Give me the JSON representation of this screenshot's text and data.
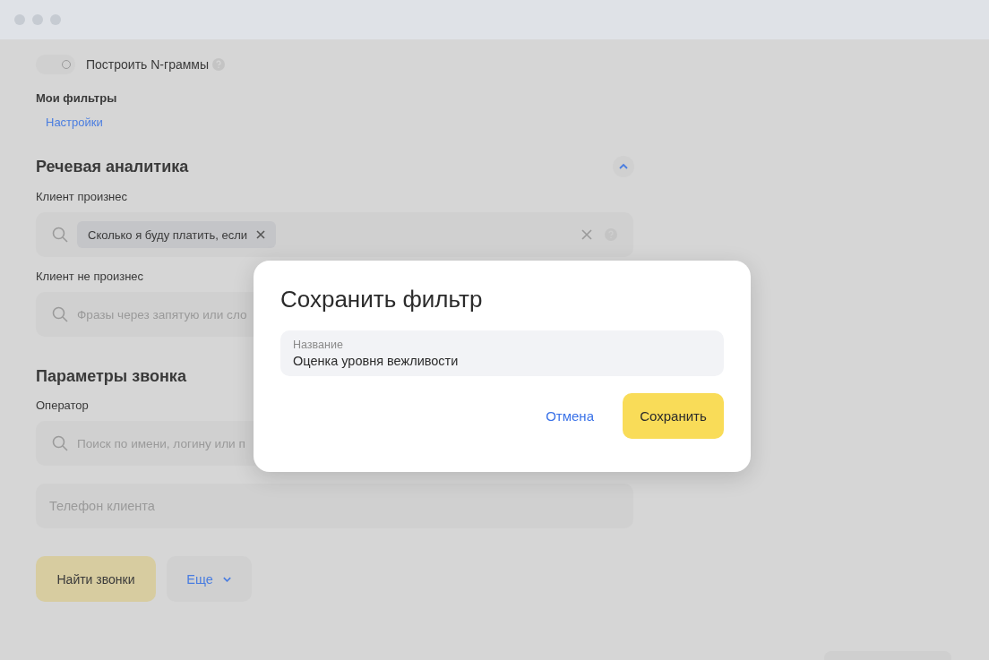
{
  "ngram_toggle": {
    "label": "Построить N-граммы",
    "on": false
  },
  "my_filters": {
    "title": "Мои фильтры",
    "link": "Настройки"
  },
  "speech_section": {
    "title": "Речевая аналитика",
    "expanded": true,
    "fields": [
      {
        "label": "Клиент произнес",
        "chips": [
          "Сколько я буду платить, если"
        ]
      },
      {
        "label": "Клиент не произнес",
        "placeholder": "Фразы через запятую или сло"
      }
    ]
  },
  "call_section": {
    "title": "Параметры звонка",
    "operator_label": "Оператор",
    "operator_placeholder": "Поиск по имени, логину или п",
    "phone_placeholder": "Телефон клиента"
  },
  "actions": {
    "find": "Найти звонки",
    "more": "Еще"
  },
  "dialog": {
    "title": "Сохранить фильтр",
    "field_label": "Название",
    "field_value": "Оценка уровня вежливости",
    "cancel": "Отмена",
    "save": "Сохранить"
  }
}
